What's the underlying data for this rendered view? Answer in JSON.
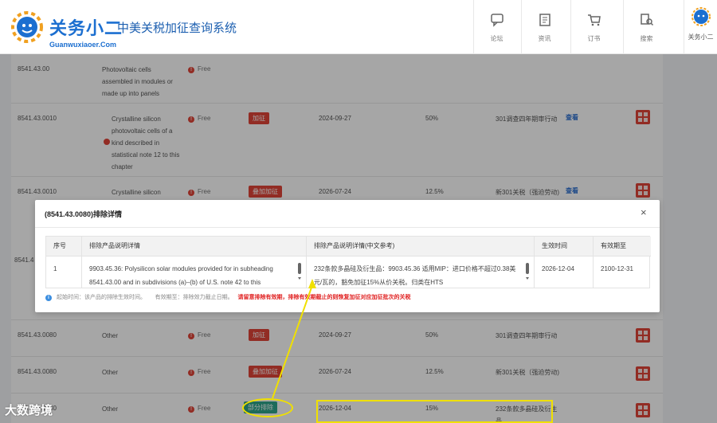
{
  "header": {
    "brand_cn": "关务小二",
    "brand_en": "Guanwuxiaoer.Com",
    "site_title": "中美关税加征查询系统",
    "nav": [
      {
        "label": "论坛",
        "icon": "chat-icon"
      },
      {
        "label": "资讯",
        "icon": "news-icon"
      },
      {
        "label": "订书",
        "icon": "cart-icon"
      },
      {
        "label": "搜索",
        "icon": "search-icon"
      }
    ],
    "brand_nav_label": "关务小二"
  },
  "rows": [
    {
      "code": "8541.43.00",
      "desc": "Photovoltaic cells assembled in modules or made up into panels",
      "free": "Free",
      "tag": "",
      "date": "",
      "rate": "",
      "note": "",
      "link": ""
    },
    {
      "code": "8541.43.0010",
      "desc": "Crystalline silicon photovoltaic cells of a kind described in statistical note 12 to this chapter",
      "free": "Free",
      "tag": "加征",
      "date": "2024-09-27",
      "rate": "50%",
      "note": "301调查四年期审行动",
      "link": "查看"
    },
    {
      "code": "8541.43.0010",
      "desc": "Crystalline silicon photovoltaic cells of a",
      "free": "Free",
      "tag": "叠加加征",
      "date": "2026-07-24",
      "rate": "12.5%",
      "note": "新301关税（强迫劳动)",
      "link": "查看"
    },
    {
      "code": "8541.43.0080",
      "desc": "Other",
      "free": "Free",
      "tag": "加征",
      "date": "2024-09-27",
      "rate": "50%",
      "note": "301调查四年期审行动",
      "link": ""
    },
    {
      "code": "8541.43.0080",
      "desc": "Other",
      "free": "Free",
      "tag": "叠加加征",
      "date": "2026-07-24",
      "rate": "12.5%",
      "note": "新301关税（强迫劳动)",
      "link": ""
    },
    {
      "code": "8541.43.0080",
      "desc": "Other",
      "free": "Free",
      "tag": "部分排除",
      "date": "2026-12-04",
      "rate": "15%",
      "note": "232条款多晶硅及衍生品",
      "link": ""
    }
  ],
  "partial_code": "8541.4",
  "modal": {
    "title": "(8541.43.0080)排除详情",
    "close": "×",
    "columns": [
      "序号",
      "排除产品说明详情",
      "排除产品说明详情(中文参考)",
      "生效时间",
      "有效期至"
    ],
    "row": {
      "index": "1",
      "desc_en": "9903.45.36: Polysilicon solar modules provided for in subheading 8541.43.00 and in subdivisions (a)–(b) of U.S. note 42 to this",
      "desc_cn": "232条款多晶硅及衍生品：9903.45.36 适用MIP：进口价格不超过0.38美元/瓦的，豁免加征15%从价关税。归类在HTS",
      "effective": "2026-12-04",
      "expires": "2100-12-31"
    },
    "footer_info": "起始时间：该产品的排除生效时间。",
    "footer_valid": "有效期至：排除效力截止日期。",
    "footer_warn": "请留意排除有效期，排除有效期截止的则恢复加征对应加征批次的关税"
  },
  "watermark": "大数跨境",
  "colors": {
    "brand_blue": "#1c6fd0",
    "tag_red": "#e04438",
    "tag_green": "#2ea58a",
    "annotation_yellow": "#f0e000",
    "warn_red": "#e02020"
  }
}
